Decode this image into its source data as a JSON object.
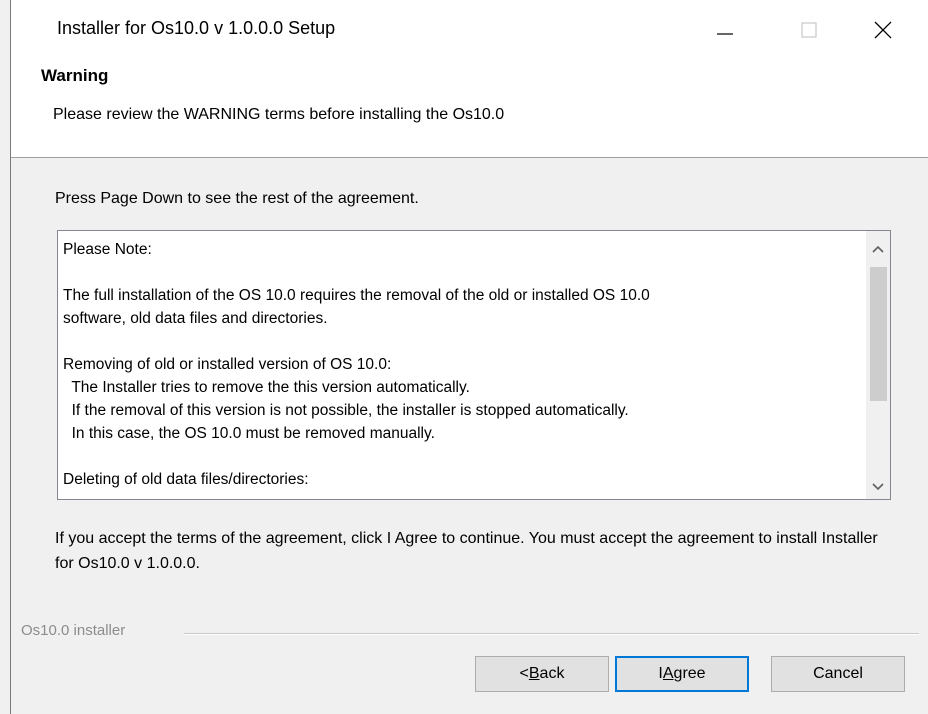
{
  "window": {
    "title": "Installer for Os10.0 v 1.0.0.0 Setup"
  },
  "controls": {
    "minimize_icon": "minimize-icon",
    "maximize_icon": "maximize-icon",
    "close_icon": "close-icon"
  },
  "header": {
    "title": "Warning",
    "subtitle": "Please review the WARNING terms before installing the Os10.0"
  },
  "instruction": "Press Page Down to see the rest of the agreement.",
  "license": {
    "lines": [
      "Please Note:",
      "",
      "The full installation of the OS 10.0 requires the removal of the old or installed OS 10.0",
      "software, old data files and directories.",
      "",
      "Removing of old or installed version of OS 10.0:",
      "  The Installer tries to remove the this version automatically.",
      "  If the removal of this version is not possible, the installer is stopped automatically.",
      "  In this case, the OS 10.0 must be removed manually.",
      "",
      "Deleting of old data files/directories:"
    ]
  },
  "accept_text": "If you accept the terms of the agreement, click I Agree to continue. You must accept the agreement to install Installer for Os10.0 v 1.0.0.0.",
  "branding": "Os10.0 installer",
  "buttons": {
    "back_prefix": "< ",
    "back_mnemonic": "B",
    "back_rest": "ack",
    "agree_prefix": "I ",
    "agree_mnemonic": "A",
    "agree_rest": "gree",
    "cancel": "Cancel"
  }
}
